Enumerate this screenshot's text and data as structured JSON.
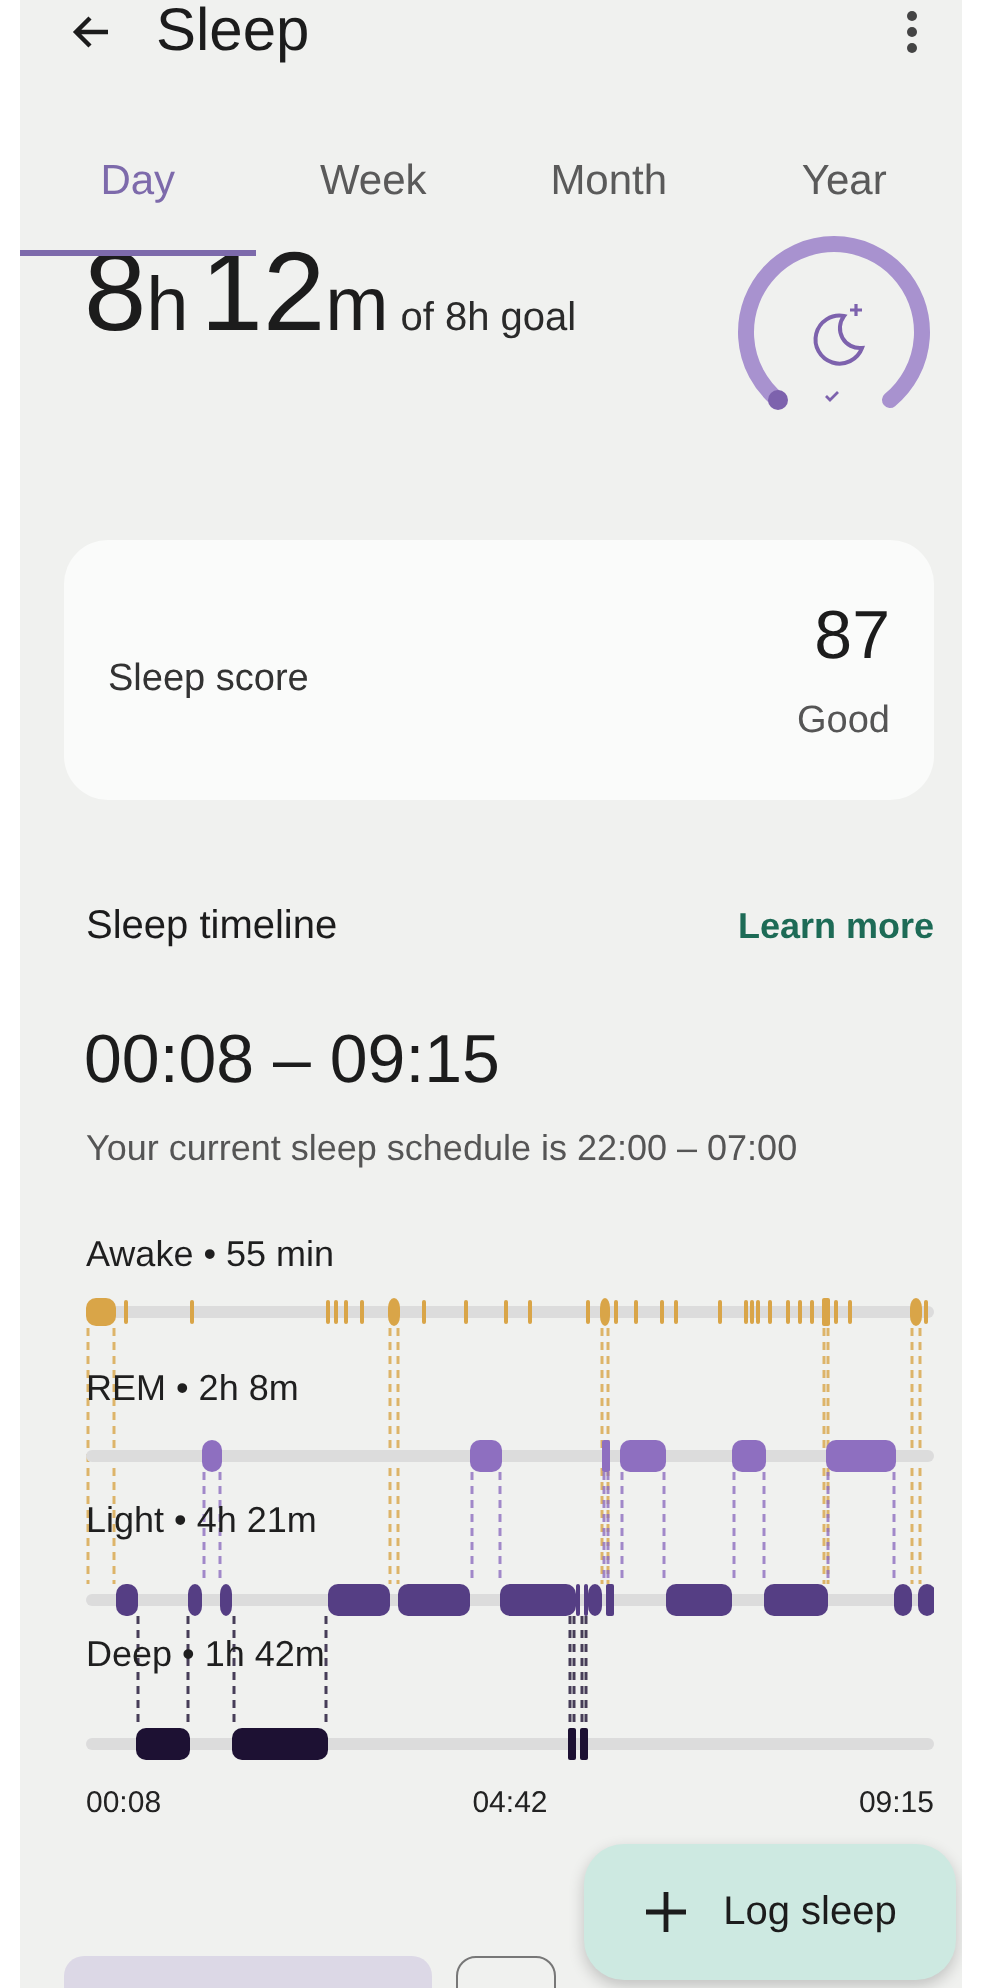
{
  "header": {
    "title": "Sleep"
  },
  "tabs": [
    {
      "label": "Day",
      "selected": true
    },
    {
      "label": "Week",
      "selected": false
    },
    {
      "label": "Month",
      "selected": false
    },
    {
      "label": "Year",
      "selected": false
    }
  ],
  "summary": {
    "hours": "8",
    "hours_unit": "h",
    "minutes": "12",
    "minutes_unit": "m",
    "goal": "of 8h goal"
  },
  "score_card": {
    "label": "Sleep score",
    "value": "87",
    "rating": "Good"
  },
  "timeline": {
    "title": "Sleep timeline",
    "link": "Learn more",
    "range": "00:08 – 09:15",
    "schedule": "Your current sleep schedule is 22:00 – 07:00",
    "stages": [
      {
        "kind": "awake",
        "label": "Awake • 55 min"
      },
      {
        "kind": "rem",
        "label": "REM • 2h 8m"
      },
      {
        "kind": "light",
        "label": "Light • 4h 21m"
      },
      {
        "kind": "deep",
        "label": "Deep • 1h 42m"
      }
    ],
    "axis": [
      "00:08",
      "04:42",
      "09:15"
    ]
  },
  "fab": {
    "label": "Log sleep"
  },
  "chips": [
    {
      "selected": true
    },
    {
      "selected": false
    }
  ]
}
